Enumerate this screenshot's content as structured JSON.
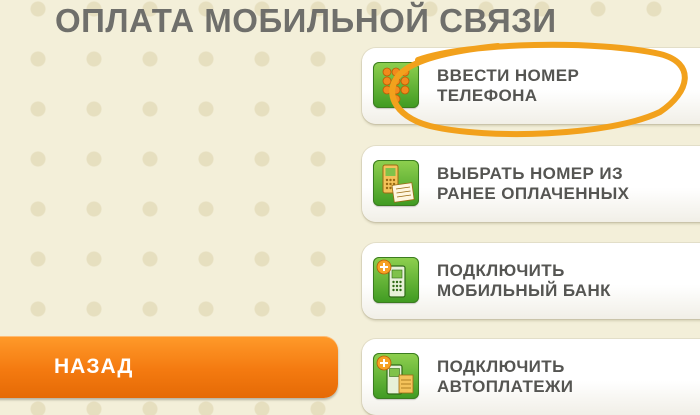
{
  "page": {
    "title": "ОПЛАТА МОБИЛЬНОЙ СВЯЗИ"
  },
  "menu": {
    "items": [
      {
        "line1": "ВВЕСТИ НОМЕР",
        "line2": "ТЕЛЕФОНА",
        "icon": "keypad-icon"
      },
      {
        "line1": "ВЫБРАТЬ НОМЕР ИЗ",
        "line2": "РАНЕЕ ОПЛАЧЕННЫХ",
        "icon": "phone-receipt-icon"
      },
      {
        "line1": "ПОДКЛЮЧИТЬ",
        "line2": "МОБИЛЬНЫЙ БАНК",
        "icon": "mobile-bank-icon"
      },
      {
        "line1": "ПОДКЛЮЧИТЬ",
        "line2": "АВТОПЛАТЕЖИ",
        "icon": "autopay-icon"
      }
    ]
  },
  "navigation": {
    "back_label": "НАЗАД"
  },
  "colors": {
    "background": "#f3efd9",
    "accent_orange": "#f47a10",
    "icon_green": "#4ca52a",
    "text_gray": "#555552",
    "highlight_ring": "#f2a11c"
  }
}
